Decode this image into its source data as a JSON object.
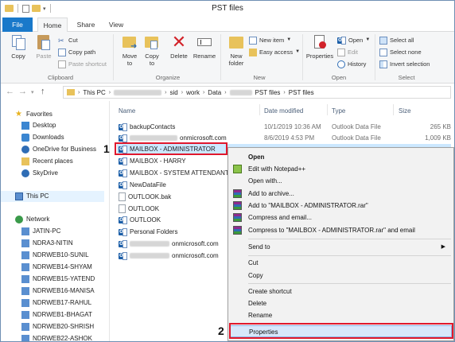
{
  "window": {
    "title": "PST files"
  },
  "ribbon_tabs": [
    "File",
    "Home",
    "Share",
    "View"
  ],
  "ribbon": {
    "clipboard": {
      "label": "Clipboard",
      "copy": "Copy",
      "paste": "Paste",
      "cut": "Cut",
      "copy_path": "Copy path",
      "paste_shortcut": "Paste shortcut"
    },
    "organize": {
      "label": "Organize",
      "move_to": "Move\nto",
      "copy_to": "Copy\nto",
      "delete": "Delete",
      "rename": "Rename"
    },
    "new": {
      "label": "New",
      "new_folder": "New\nfolder",
      "new_item": "New item",
      "easy_access": "Easy access"
    },
    "open": {
      "label": "Open",
      "properties": "Properties",
      "open": "Open",
      "edit": "Edit",
      "history": "History"
    },
    "select": {
      "label": "Select",
      "select_all": "Select all",
      "select_none": "Select none",
      "invert_selection": "Invert selection"
    }
  },
  "address": {
    "crumbs": [
      "This PC",
      "sid",
      "work",
      "Data",
      "PST files",
      "PST files"
    ]
  },
  "nav": {
    "favorites": "Favorites",
    "desktop": "Desktop",
    "downloads": "Downloads",
    "onedrive": "OneDrive for Business",
    "recent": "Recent places",
    "skydrive": "SkyDrive",
    "thispc": "This PC",
    "network": "Network",
    "computers": [
      "JATIN-PC",
      "NDRA3-NITIN",
      "NDRWEB10-SUNIL",
      "NDRWEB14-SHYAM",
      "NDRWEB15-YATEND",
      "NDRWEB16-MANISA",
      "NDRWEB17-RAHUL",
      "NDRWEB1-BHAGAT",
      "NDRWEB20-SHRISH",
      "NDRWEB22-ASHOK"
    ]
  },
  "columns": {
    "name": "Name",
    "date": "Date modified",
    "type": "Type",
    "size": "Size"
  },
  "files": [
    {
      "name": "backupContacts",
      "date": "10/1/2019 10:36 AM",
      "type": "Outlook Data File",
      "size": "265 KB",
      "icon": "outlook"
    },
    {
      "name": "onmicrosoft.com",
      "date": "8/6/2019 4:53 PM",
      "type": "Outlook Data File",
      "size": "1,009 KB",
      "icon": "outlook"
    },
    {
      "name": "MAILBOX - ADMINISTRATOR",
      "date": "",
      "type": "",
      "size": "",
      "icon": "outlook"
    },
    {
      "name": "MAILBOX - HARRY",
      "date": "",
      "type": "",
      "size": "",
      "icon": "outlook"
    },
    {
      "name": "MAILBOX - SYSTEM ATTENDANT",
      "date": "",
      "type": "",
      "size": "",
      "icon": "outlook"
    },
    {
      "name": "NewDataFile",
      "date": "",
      "type": "",
      "size": "",
      "icon": "outlook"
    },
    {
      "name": "OUTLOOK.bak",
      "date": "",
      "type": "",
      "size": "",
      "icon": "doc"
    },
    {
      "name": "OUTLOOK",
      "date": "",
      "type": "",
      "size": "",
      "icon": "doc"
    },
    {
      "name": "OUTLOOK",
      "date": "",
      "type": "",
      "size": "",
      "icon": "outlook"
    },
    {
      "name": "Personal Folders",
      "date": "",
      "type": "",
      "size": "",
      "icon": "outlook"
    },
    {
      "name": "onmicrosoft.com",
      "date": "",
      "type": "",
      "size": "",
      "icon": "outlook"
    },
    {
      "name": "onmicrosoft.com",
      "date": "",
      "type": "",
      "size": "",
      "icon": "outlook"
    }
  ],
  "markers": {
    "one": "1",
    "two": "2"
  },
  "context_menu": [
    {
      "label": "Open",
      "bold": true,
      "icon": ""
    },
    {
      "label": "Edit with Notepad++",
      "icon": "notepad"
    },
    {
      "label": "Open with...",
      "icon": ""
    },
    {
      "label": "Add to archive...",
      "icon": "rar"
    },
    {
      "label": "Add to \"MAILBOX - ADMINISTRATOR.rar\"",
      "icon": "rar"
    },
    {
      "label": "Compress and email...",
      "icon": "rar"
    },
    {
      "label": "Compress to \"MAILBOX - ADMINISTRATOR.rar\" and email",
      "icon": "rar"
    },
    {
      "label": "Send to",
      "icon": "",
      "submenu": true
    },
    {
      "label": "Cut",
      "icon": ""
    },
    {
      "label": "Copy",
      "icon": ""
    },
    {
      "label": "Create shortcut",
      "icon": ""
    },
    {
      "label": "Delete",
      "icon": ""
    },
    {
      "label": "Rename",
      "icon": ""
    },
    {
      "label": "Properties",
      "icon": ""
    }
  ]
}
